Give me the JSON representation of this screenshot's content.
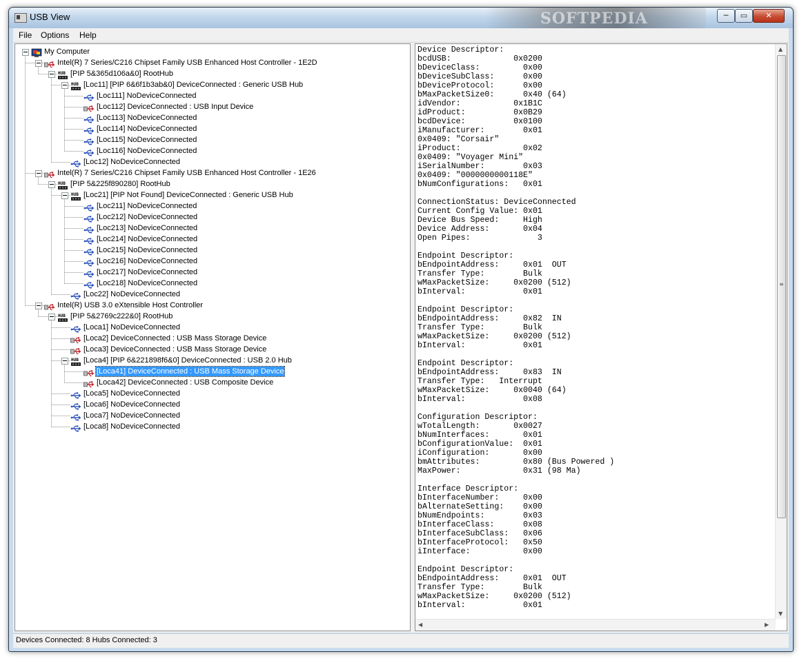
{
  "window": {
    "title": "USB View",
    "watermark": "SOFTPEDIA",
    "controls": {
      "minimize": "─",
      "maximize": "▭",
      "close": "✕"
    }
  },
  "menu": [
    "File",
    "Options",
    "Help"
  ],
  "tree": [
    {
      "depth": 0,
      "icon": "computer",
      "label": "My Computer",
      "expander": "minus"
    },
    {
      "depth": 1,
      "icon": "usb-device",
      "label": "Intel(R) 7 Series/C216 Chipset Family USB Enhanced Host Controller - 1E2D",
      "expander": "minus"
    },
    {
      "depth": 2,
      "icon": "hub",
      "label": "[PIP 5&365d106a&0] RootHub",
      "expander": "minus"
    },
    {
      "depth": 3,
      "icon": "hub",
      "label": "[Loc11] [PIP 6&6f1b3ab&0] DeviceConnected :  Generic USB Hub",
      "expander": "minus"
    },
    {
      "depth": 4,
      "icon": "usb-port",
      "label": "[Loc111] NoDeviceConnected"
    },
    {
      "depth": 4,
      "icon": "usb-device",
      "label": "[Loc112] DeviceConnected :  USB Input Device"
    },
    {
      "depth": 4,
      "icon": "usb-port",
      "label": "[Loc113] NoDeviceConnected"
    },
    {
      "depth": 4,
      "icon": "usb-port",
      "label": "[Loc114] NoDeviceConnected"
    },
    {
      "depth": 4,
      "icon": "usb-port",
      "label": "[Loc115] NoDeviceConnected"
    },
    {
      "depth": 4,
      "icon": "usb-port",
      "label": "[Loc116] NoDeviceConnected"
    },
    {
      "depth": 3,
      "icon": "usb-port",
      "label": "[Loc12] NoDeviceConnected"
    },
    {
      "depth": 1,
      "icon": "usb-device",
      "label": "Intel(R) 7 Series/C216 Chipset Family USB Enhanced Host Controller - 1E26",
      "expander": "minus"
    },
    {
      "depth": 2,
      "icon": "hub",
      "label": "[PIP 5&225f890280] RootHub",
      "expander": "minus"
    },
    {
      "depth": 3,
      "icon": "hub",
      "label": "[Loc21] [PIP Not Found] DeviceConnected :  Generic USB Hub",
      "expander": "minus"
    },
    {
      "depth": 4,
      "icon": "usb-port",
      "label": "[Loc211] NoDeviceConnected"
    },
    {
      "depth": 4,
      "icon": "usb-port",
      "label": "[Loc212] NoDeviceConnected"
    },
    {
      "depth": 4,
      "icon": "usb-port",
      "label": "[Loc213] NoDeviceConnected"
    },
    {
      "depth": 4,
      "icon": "usb-port",
      "label": "[Loc214] NoDeviceConnected"
    },
    {
      "depth": 4,
      "icon": "usb-port",
      "label": "[Loc215] NoDeviceConnected"
    },
    {
      "depth": 4,
      "icon": "usb-port",
      "label": "[Loc216] NoDeviceConnected"
    },
    {
      "depth": 4,
      "icon": "usb-port",
      "label": "[Loc217] NoDeviceConnected"
    },
    {
      "depth": 4,
      "icon": "usb-port",
      "label": "[Loc218] NoDeviceConnected"
    },
    {
      "depth": 3,
      "icon": "usb-port",
      "label": "[Loc22] NoDeviceConnected"
    },
    {
      "depth": 1,
      "icon": "usb-device",
      "label": "Intel(R) USB 3.0 eXtensible Host Controller",
      "expander": "minus"
    },
    {
      "depth": 2,
      "icon": "hub",
      "label": "[PIP 5&2769c222&0] RootHub",
      "expander": "minus"
    },
    {
      "depth": 3,
      "icon": "usb-port",
      "label": "[Loca1] NoDeviceConnected"
    },
    {
      "depth": 3,
      "icon": "usb-device",
      "label": "[Loca2] DeviceConnected :  USB Mass Storage Device"
    },
    {
      "depth": 3,
      "icon": "usb-device",
      "label": "[Loca3] DeviceConnected :  USB Mass Storage Device"
    },
    {
      "depth": 3,
      "icon": "hub",
      "label": "[Loca4] [PIP 6&221898f6&0] DeviceConnected :  USB 2.0 Hub",
      "expander": "minus"
    },
    {
      "depth": 4,
      "icon": "usb-device",
      "label": "[Loca41] DeviceConnected :  USB Mass Storage Device",
      "selected": true
    },
    {
      "depth": 4,
      "icon": "usb-device",
      "label": "[Loca42] DeviceConnected :  USB Composite Device"
    },
    {
      "depth": 3,
      "icon": "usb-port",
      "label": "[Loca5] NoDeviceConnected"
    },
    {
      "depth": 3,
      "icon": "usb-port",
      "label": "[Loca6] NoDeviceConnected"
    },
    {
      "depth": 3,
      "icon": "usb-port",
      "label": "[Loca7] NoDeviceConnected"
    },
    {
      "depth": 3,
      "icon": "usb-port",
      "label": "[Loca8] NoDeviceConnected"
    }
  ],
  "details": [
    "Device Descriptor:",
    "bcdUSB:             0x0200",
    "bDeviceClass:         0x00",
    "bDeviceSubClass:      0x00",
    "bDeviceProtocol:      0x00",
    "bMaxPacketSize0:      0x40 (64)",
    "idVendor:           0x1B1C",
    "idProduct:          0x0B29",
    "bcdDevice:          0x0100",
    "iManufacturer:        0x01",
    "0x0409: \"Corsair\"",
    "iProduct:             0x02",
    "0x0409: \"Voyager Mini\"",
    "iSerialNumber:        0x03",
    "0x0409: \"0000000000118E\"",
    "bNumConfigurations:   0x01",
    "",
    "ConnectionStatus: DeviceConnected",
    "Current Config Value: 0x01",
    "Device Bus Speed:     High",
    "Device Address:       0x04",
    "Open Pipes:              3",
    "",
    "Endpoint Descriptor:",
    "bEndpointAddress:     0x01  OUT",
    "Transfer Type:        Bulk",
    "wMaxPacketSize:     0x0200 (512)",
    "bInterval:            0x01",
    "",
    "Endpoint Descriptor:",
    "bEndpointAddress:     0x82  IN",
    "Transfer Type:        Bulk",
    "wMaxPacketSize:     0x0200 (512)",
    "bInterval:            0x01",
    "",
    "Endpoint Descriptor:",
    "bEndpointAddress:     0x83  IN",
    "Transfer Type:   Interrupt",
    "wMaxPacketSize:     0x0040 (64)",
    "bInterval:            0x08",
    "",
    "Configuration Descriptor:",
    "wTotalLength:       0x0027",
    "bNumInterfaces:       0x01",
    "bConfigurationValue:  0x01",
    "iConfiguration:       0x00",
    "bmAttributes:         0x80 (Bus Powered )",
    "MaxPower:             0x31 (98 Ma)",
    "",
    "Interface Descriptor:",
    "bInterfaceNumber:     0x00",
    "bAlternateSetting:    0x00",
    "bNumEndpoints:        0x03",
    "bInterfaceClass:      0x08",
    "bInterfaceSubClass:   0x06",
    "bInterfaceProtocol:   0x50",
    "iInterface:           0x00",
    "",
    "Endpoint Descriptor:",
    "bEndpointAddress:     0x01  OUT",
    "Transfer Type:        Bulk",
    "wMaxPacketSize:     0x0200 (512)",
    "bInterval:            0x01"
  ],
  "status_bar": {
    "text": "Devices Connected: 8   Hubs Connected: 3"
  },
  "colors": {
    "selection": "#3399ff",
    "usb_port_icon": "#2a52be",
    "usb_device_icon": "#c0272d"
  },
  "scroll_glyphs": {
    "up": "▲",
    "down": "▼",
    "left": "◀",
    "right": "▶"
  }
}
